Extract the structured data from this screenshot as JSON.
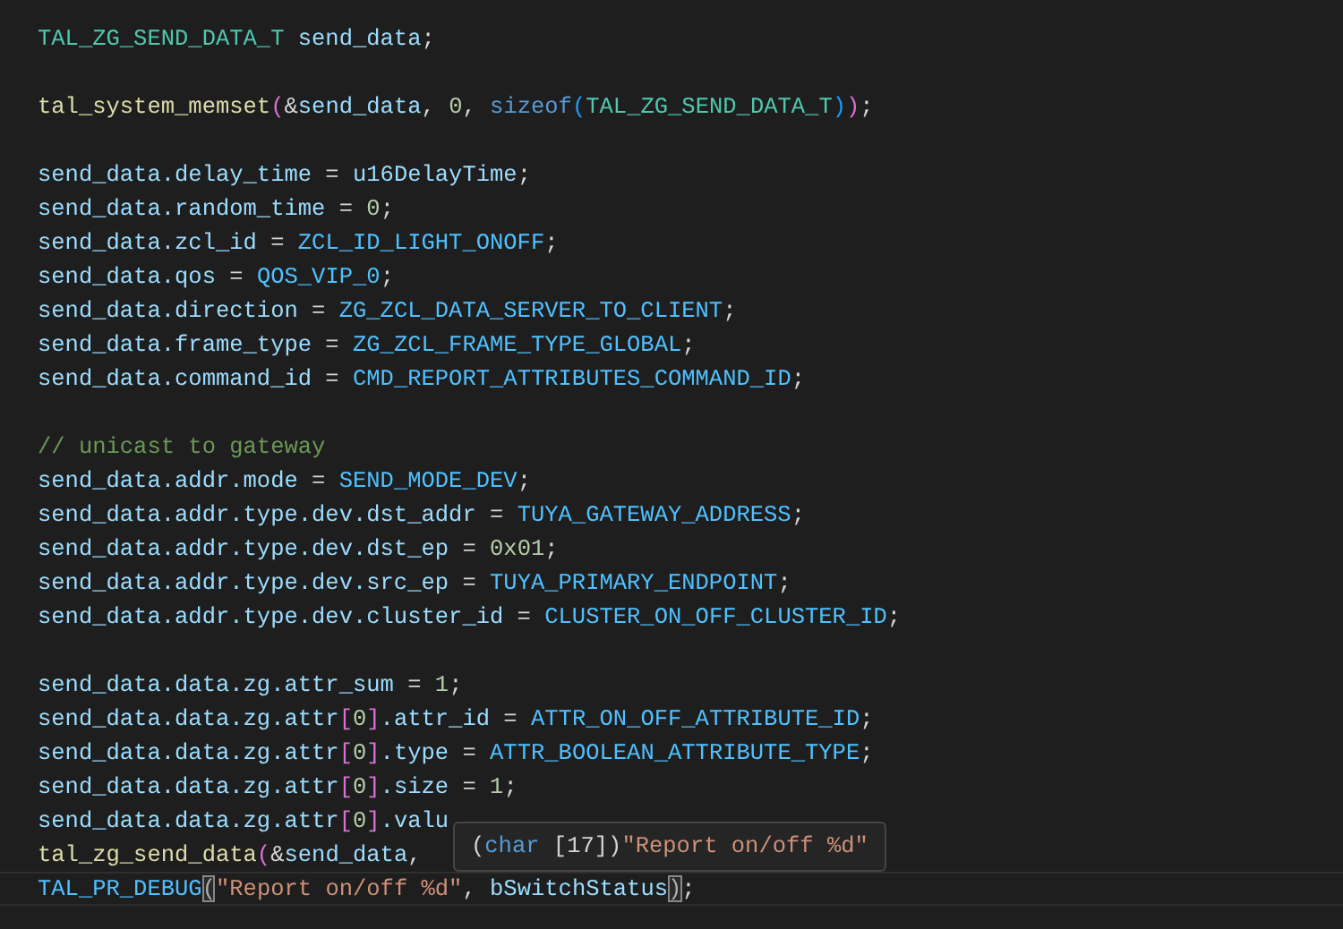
{
  "editor": {
    "lines": [
      {
        "current": false,
        "tokens": [
          {
            "kind": "type",
            "text": "TAL_ZG_SEND_DATA_T "
          },
          {
            "kind": "variable",
            "text": "send_data"
          },
          {
            "kind": "punct",
            "text": ";"
          }
        ]
      },
      {
        "current": false
      },
      {
        "current": false,
        "tokens": [
          {
            "kind": "function",
            "text": "tal_system_memset"
          },
          {
            "kind": "bracket2",
            "text": "("
          },
          {
            "kind": "punct",
            "text": "&"
          },
          {
            "kind": "variable",
            "text": "send_data"
          },
          {
            "kind": "punct",
            "text": ", "
          },
          {
            "kind": "number",
            "text": "0"
          },
          {
            "kind": "punct",
            "text": ", "
          },
          {
            "kind": "keyword",
            "text": "sizeof"
          },
          {
            "kind": "bracket3",
            "text": "("
          },
          {
            "kind": "type",
            "text": "TAL_ZG_SEND_DATA_T"
          },
          {
            "kind": "bracket3",
            "text": ")"
          },
          {
            "kind": "bracket2",
            "text": ")"
          },
          {
            "kind": "punct",
            "text": ";"
          }
        ]
      },
      {
        "current": false
      },
      {
        "current": false,
        "tokens": [
          {
            "kind": "variable",
            "text": "send_data.delay_time"
          },
          {
            "kind": "punct",
            "text": " = "
          },
          {
            "kind": "variable",
            "text": "u16DelayTime"
          },
          {
            "kind": "punct",
            "text": ";"
          }
        ]
      },
      {
        "current": false,
        "tokens": [
          {
            "kind": "variable",
            "text": "send_data.random_time"
          },
          {
            "kind": "punct",
            "text": " = "
          },
          {
            "kind": "number",
            "text": "0"
          },
          {
            "kind": "punct",
            "text": ";"
          }
        ]
      },
      {
        "current": false,
        "tokens": [
          {
            "kind": "variable",
            "text": "send_data.zcl_id"
          },
          {
            "kind": "punct",
            "text": " = "
          },
          {
            "kind": "macro",
            "text": "ZCL_ID_LIGHT_ONOFF"
          },
          {
            "kind": "punct",
            "text": ";"
          }
        ]
      },
      {
        "current": false,
        "tokens": [
          {
            "kind": "variable",
            "text": "send_data.qos"
          },
          {
            "kind": "punct",
            "text": " = "
          },
          {
            "kind": "macro",
            "text": "QOS_VIP_0"
          },
          {
            "kind": "punct",
            "text": ";"
          }
        ]
      },
      {
        "current": false,
        "tokens": [
          {
            "kind": "variable",
            "text": "send_data.direction"
          },
          {
            "kind": "punct",
            "text": " = "
          },
          {
            "kind": "macro",
            "text": "ZG_ZCL_DATA_SERVER_TO_CLIENT"
          },
          {
            "kind": "punct",
            "text": ";"
          }
        ]
      },
      {
        "current": false,
        "tokens": [
          {
            "kind": "variable",
            "text": "send_data.frame_type"
          },
          {
            "kind": "punct",
            "text": " = "
          },
          {
            "kind": "macro",
            "text": "ZG_ZCL_FRAME_TYPE_GLOBAL"
          },
          {
            "kind": "punct",
            "text": ";"
          }
        ]
      },
      {
        "current": false,
        "tokens": [
          {
            "kind": "variable",
            "text": "send_data.command_id"
          },
          {
            "kind": "punct",
            "text": " = "
          },
          {
            "kind": "macro",
            "text": "CMD_REPORT_ATTRIBUTES_COMMAND_ID"
          },
          {
            "kind": "punct",
            "text": ";"
          }
        ]
      },
      {
        "current": false
      },
      {
        "current": false,
        "tokens": [
          {
            "kind": "comment",
            "text": "// unicast to gateway"
          }
        ]
      },
      {
        "current": false,
        "tokens": [
          {
            "kind": "variable",
            "text": "send_data.addr.mode"
          },
          {
            "kind": "punct",
            "text": " = "
          },
          {
            "kind": "macro",
            "text": "SEND_MODE_DEV"
          },
          {
            "kind": "punct",
            "text": ";"
          }
        ]
      },
      {
        "current": false,
        "tokens": [
          {
            "kind": "variable",
            "text": "send_data.addr.type.dev.dst_addr"
          },
          {
            "kind": "punct",
            "text": " = "
          },
          {
            "kind": "macro",
            "text": "TUYA_GATEWAY_ADDRESS"
          },
          {
            "kind": "punct",
            "text": ";"
          }
        ]
      },
      {
        "current": false,
        "tokens": [
          {
            "kind": "variable",
            "text": "send_data.addr.type.dev.dst_ep"
          },
          {
            "kind": "punct",
            "text": " = "
          },
          {
            "kind": "number",
            "text": "0x01"
          },
          {
            "kind": "punct",
            "text": ";"
          }
        ]
      },
      {
        "current": false,
        "tokens": [
          {
            "kind": "variable",
            "text": "send_data.addr.type.dev.src_ep"
          },
          {
            "kind": "punct",
            "text": " = "
          },
          {
            "kind": "macro",
            "text": "TUYA_PRIMARY_ENDPOINT"
          },
          {
            "kind": "punct",
            "text": ";"
          }
        ]
      },
      {
        "current": false,
        "tokens": [
          {
            "kind": "variable",
            "text": "send_data.addr.type.dev.cluster_id"
          },
          {
            "kind": "punct",
            "text": " = "
          },
          {
            "kind": "macro",
            "text": "CLUSTER_ON_OFF_CLUSTER_ID"
          },
          {
            "kind": "punct",
            "text": ";"
          }
        ]
      },
      {
        "current": false
      },
      {
        "current": false,
        "tokens": [
          {
            "kind": "variable",
            "text": "send_data.data.zg.attr_sum"
          },
          {
            "kind": "punct",
            "text": " = "
          },
          {
            "kind": "number",
            "text": "1"
          },
          {
            "kind": "punct",
            "text": ";"
          }
        ]
      },
      {
        "current": false,
        "tokens": [
          {
            "kind": "variable",
            "text": "send_data.data.zg.attr"
          },
          {
            "kind": "bracket2",
            "text": "["
          },
          {
            "kind": "number",
            "text": "0"
          },
          {
            "kind": "bracket2",
            "text": "]"
          },
          {
            "kind": "variable",
            "text": ".attr_id"
          },
          {
            "kind": "punct",
            "text": " = "
          },
          {
            "kind": "macro",
            "text": "ATTR_ON_OFF_ATTRIBUTE_ID"
          },
          {
            "kind": "punct",
            "text": ";"
          }
        ]
      },
      {
        "current": false,
        "tokens": [
          {
            "kind": "variable",
            "text": "send_data.data.zg.attr"
          },
          {
            "kind": "bracket2",
            "text": "["
          },
          {
            "kind": "number",
            "text": "0"
          },
          {
            "kind": "bracket2",
            "text": "]"
          },
          {
            "kind": "variable",
            "text": ".type"
          },
          {
            "kind": "punct",
            "text": " = "
          },
          {
            "kind": "macro",
            "text": "ATTR_BOOLEAN_ATTRIBUTE_TYPE"
          },
          {
            "kind": "punct",
            "text": ";"
          }
        ]
      },
      {
        "current": false,
        "tokens": [
          {
            "kind": "variable",
            "text": "send_data.data.zg.attr"
          },
          {
            "kind": "bracket2",
            "text": "["
          },
          {
            "kind": "number",
            "text": "0"
          },
          {
            "kind": "bracket2",
            "text": "]"
          },
          {
            "kind": "variable",
            "text": ".size"
          },
          {
            "kind": "punct",
            "text": " = "
          },
          {
            "kind": "number",
            "text": "1"
          },
          {
            "kind": "punct",
            "text": ";"
          }
        ]
      },
      {
        "current": false,
        "tokens": [
          {
            "kind": "variable",
            "text": "send_data.data.zg.attr"
          },
          {
            "kind": "bracket2",
            "text": "["
          },
          {
            "kind": "number",
            "text": "0"
          },
          {
            "kind": "bracket2",
            "text": "]"
          },
          {
            "kind": "variable",
            "text": ".valu"
          }
        ]
      },
      {
        "current": false,
        "tokens": [
          {
            "kind": "function",
            "text": "tal_zg_send_data"
          },
          {
            "kind": "bracket2",
            "text": "("
          },
          {
            "kind": "punct",
            "text": "&"
          },
          {
            "kind": "variable",
            "text": "send_data"
          },
          {
            "kind": "punct",
            "text": ","
          }
        ]
      },
      {
        "current": true,
        "tokens": [
          {
            "kind": "macro",
            "text": "TAL_PR_DEBUG"
          },
          {
            "kind": "bracket2",
            "text": "(",
            "matched": true
          },
          {
            "kind": "string",
            "text": "\"Report on/off %d\""
          },
          {
            "kind": "punct",
            "text": ", "
          },
          {
            "kind": "variable",
            "text": "bSwitchStatus"
          },
          {
            "kind": "bracket2",
            "text": ")",
            "matched": true
          },
          {
            "kind": "punct",
            "text": ";"
          }
        ]
      }
    ],
    "tooltip": {
      "tokens": [
        {
          "kind": "punct",
          "text": "("
        },
        {
          "kind": "keyword",
          "text": "char"
        },
        {
          "kind": "punct",
          "text": " [17])"
        },
        {
          "kind": "string",
          "text": "\"Report on/off %d\""
        }
      ]
    }
  }
}
